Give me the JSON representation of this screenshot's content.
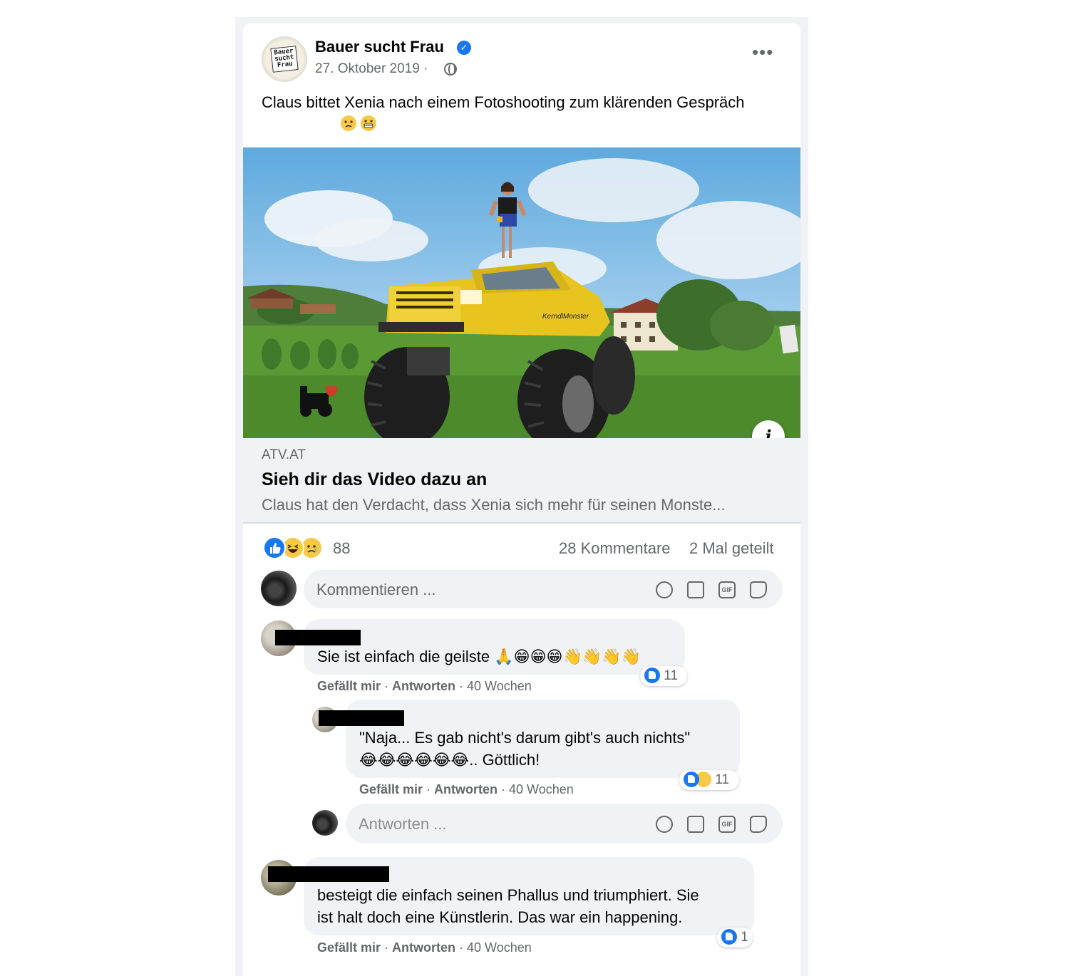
{
  "post": {
    "page_name": "Bauer sucht Frau",
    "verified_mark": "✓",
    "avatar_logo_text": "Bauer sucht Frau",
    "date": "27. Oktober 2019 ·",
    "more_menu": "•••",
    "text": "Claus bittet Xenia nach einem Fotoshooting zum klärenden Gespräch"
  },
  "link": {
    "info_label": "i",
    "domain": "ATV.AT",
    "title": "Sieh dir das Video dazu an",
    "description": "Claus hat den Verdacht, dass Xenia sich mehr für seinen Monste..."
  },
  "stats": {
    "reactions_count": "88",
    "comments": "28 Kommentare",
    "shares": "2 Mal geteilt"
  },
  "composer": {
    "placeholder": "Kommentieren ...",
    "reply_placeholder": "Antworten ...",
    "gif_label": "GIF"
  },
  "comments": [
    {
      "text": "Sie ist einfach die geilste 🙏😁😁😁👋👋👋👋",
      "like": "Gefällt mir",
      "reply": "Antworten",
      "time": "40 Wochen",
      "reactions": "11"
    },
    {
      "text_line1": "\"Naja... Es gab nicht's darum gibt's auch nichts\"",
      "text_line2": "😂😂😂😂😂😂.. Göttlich!",
      "like": "Gefällt mir",
      "reply": "Antworten",
      "time": "40 Wochen",
      "reactions": "11"
    },
    {
      "text_line1": "besteigt die einfach seinen Phallus und triumphiert. Sie",
      "text_line2": "ist halt doch eine Künstlerin. Das war ein happening.",
      "like": "Gefällt mir",
      "reply": "Antworten",
      "time": "40 Wochen",
      "reactions": "1"
    }
  ],
  "colors": {
    "facebook_blue": "#1877f2",
    "secondary_text": "#65676b",
    "bubble_bg": "#f0f2f5"
  },
  "icons": [
    "verified-badge-icon",
    "globe-icon",
    "more-icon",
    "info-icon",
    "like-reaction-icon",
    "haha-reaction-icon",
    "sad-reaction-icon",
    "emoji-icon",
    "camera-icon",
    "gif-icon",
    "sticker-icon"
  ]
}
